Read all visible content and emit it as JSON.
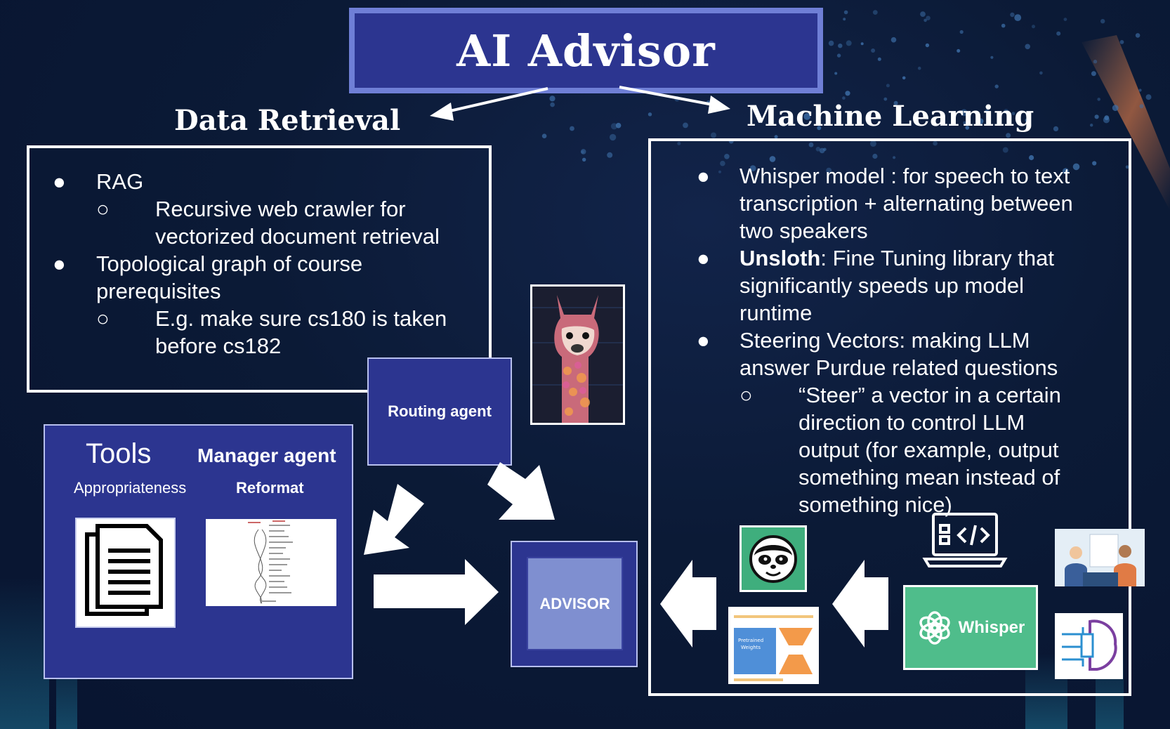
{
  "title": "AI Advisor",
  "data_retrieval": {
    "heading": "Data Retrieval",
    "items": [
      {
        "bullet": "●",
        "text": "RAG",
        "sub": [
          {
            "bullet": "○",
            "lines": [
              "Recursive web crawler for",
              "vectorized document retrieval"
            ]
          }
        ]
      },
      {
        "bullet": "●",
        "lines": [
          "Topological graph of course",
          "prerequisites"
        ],
        "sub": [
          {
            "bullet": "○",
            "lines": [
              "E.g. make sure cs180 is taken",
              "before cs182"
            ]
          }
        ]
      }
    ]
  },
  "machine_learning": {
    "heading": "Machine Learning",
    "items": [
      {
        "bullet": "●",
        "lines": [
          "Whisper model : for speech to text",
          "transcription + alternating between",
          "two speakers"
        ]
      },
      {
        "bullet": "●",
        "bold": "Unsloth",
        "lines": [
          ": Fine Tuning library that",
          "significantly speeds up model",
          "runtime"
        ]
      },
      {
        "bullet": "●",
        "lines": [
          "Steering Vectors: making LLM",
          "answer Purdue related questions"
        ],
        "sub": [
          {
            "bullet": "○",
            "lines": [
              "“Steer” a vector in a certain",
              "direction to control LLM",
              "output (for example, output",
              "something mean instead of",
              "something nice)"
            ]
          }
        ]
      }
    ]
  },
  "tools_box": {
    "tools_label": "Tools",
    "manager_label": "Manager agent",
    "appropriateness_label": "Appropriateness",
    "reformat_label": "Reformat"
  },
  "routing_agent_label": "Routing agent",
  "advisor_label": "ADVISOR",
  "whisper_label": "Whisper",
  "icons": [
    "document-icon",
    "course-graph-image",
    "llama-image",
    "sloth-icon",
    "lora-diagram",
    "laptop-code-icon",
    "openai-logo",
    "people-meeting-image",
    "brain-circuit-icon"
  ],
  "colors": {
    "navy_box": "#2c3590",
    "advisor_inner": "#7f8fd0",
    "whisper_green": "#4fbd8b",
    "sloth_green": "#3fae7d"
  }
}
